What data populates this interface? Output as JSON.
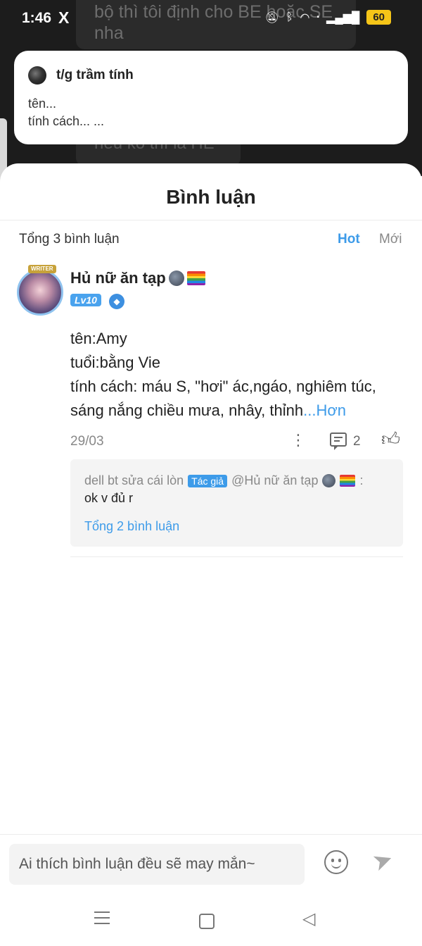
{
  "status_bar": {
    "time": "1:46",
    "notif_app": "X",
    "battery": "60"
  },
  "background": {
    "text_top": "bộ thì tôi định cho BE hoặc SE nha",
    "text_bottom": "nếu ko thì là HE"
  },
  "notification": {
    "author": "t/g trầm tính",
    "line1": "tên...",
    "line2": "tính cách... ..."
  },
  "sheet": {
    "title": "Bình luận",
    "total": "Tổng 3 bình luận",
    "sort_hot": "Hot",
    "sort_new": "Mới"
  },
  "comment": {
    "avatar_badge": "WRITER",
    "username": "Hủ nữ ăn tạp",
    "level": "Lv10",
    "lines": [
      "tên:Amy",
      "tuổi:bằng Vie",
      "tính cách: máu S, \"hơi\" ác,ngáo, nghiêm túc,",
      "sáng nắng chiều mưa, nhây, thỉnh"
    ],
    "more": "...Hơn",
    "date": "29/03",
    "reply_count": "2",
    "reply": {
      "author": "dell bt sửa cái lòn",
      "tag": "Tác giả",
      "mention": "@Hủ nữ ăn tạp",
      "colon": ":",
      "text": "ok v đủ r",
      "total": "Tổng 2 bình luận"
    }
  },
  "input": {
    "placeholder": "Ai thích bình luận đều sẽ may mắn~"
  },
  "colors": {
    "accent": "#3d9be9",
    "level_badge": "#4aa3ee",
    "battery": "#f5c518"
  }
}
